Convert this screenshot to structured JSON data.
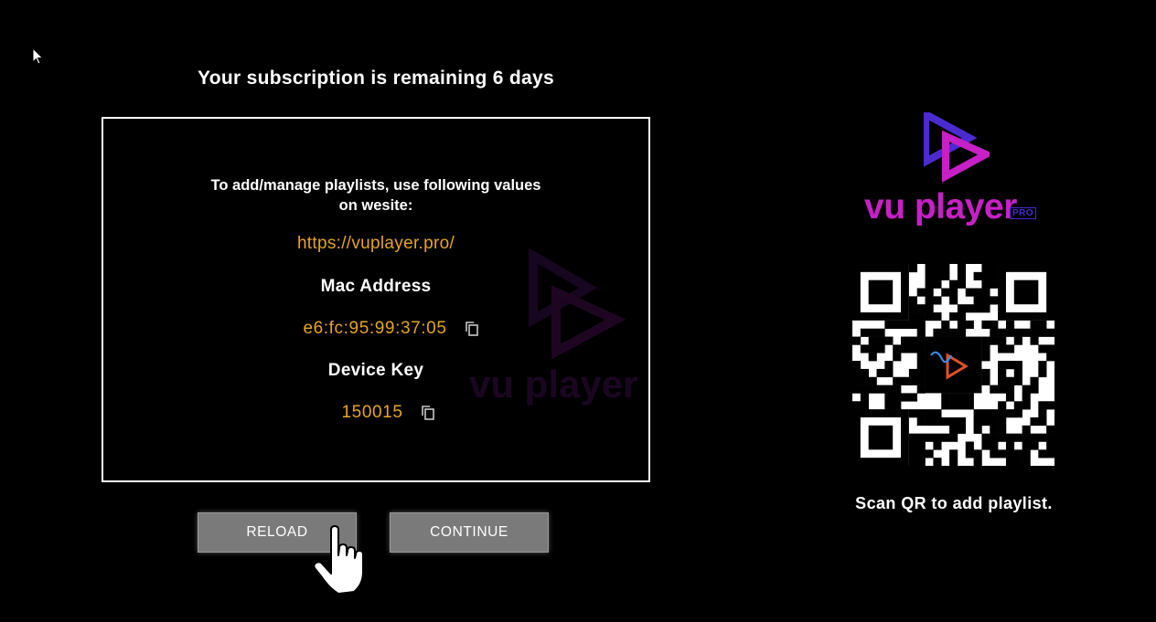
{
  "subscription": {
    "message": "Your subscription is remaining 6 days"
  },
  "info": {
    "instructions_line1": "To add/manage playlists, use following values",
    "instructions_line2": "on wesite:",
    "url": "https://vuplayer.pro/",
    "mac_label": "Mac Address",
    "mac_value": "e6:fc:95:99:37:05",
    "key_label": "Device Key",
    "key_value": "150015"
  },
  "buttons": {
    "reload": "RELOAD",
    "continue": "CONTINUE"
  },
  "brand": {
    "name": "vu player",
    "badge": "PRO",
    "colors": {
      "magenta": "#c720c7",
      "indigo": "#4b2bd0"
    }
  },
  "qr": {
    "caption": "Scan QR to add playlist."
  },
  "colors": {
    "accent_value": "#e6a522",
    "button_bg": "#7a7a7a",
    "background": "#000000"
  },
  "icons": {
    "copy": "copy-icon",
    "pointer": "arrow-cursor-icon",
    "hand": "hand-pointer-icon"
  }
}
